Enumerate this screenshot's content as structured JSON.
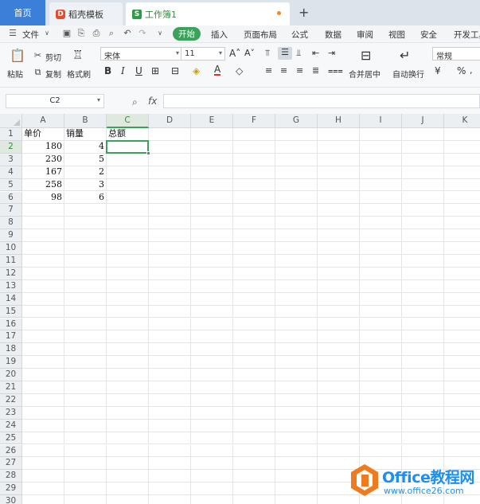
{
  "tabs": {
    "home": "首页",
    "template": "稻壳模板",
    "workbook": "工作簿1",
    "add": "+"
  },
  "menu": {
    "file": "文件",
    "items": [
      "开始",
      "插入",
      "页面布局",
      "公式",
      "数据",
      "审阅",
      "视图",
      "安全",
      "开发工具"
    ]
  },
  "ribbon": {
    "paste": "粘贴",
    "cut": "剪切",
    "copy": "复制",
    "format_painter": "格式刷",
    "font_name": "宋体",
    "font_size": "11",
    "bold": "B",
    "italic": "I",
    "underline": "U",
    "merge_center": "合并居中",
    "wrap_text": "自动换行",
    "number_format": "常规"
  },
  "formula_bar": {
    "name_box": "C2",
    "fx": "fx",
    "value": ""
  },
  "sheet": {
    "columns": [
      "A",
      "B",
      "C",
      "D",
      "E",
      "F",
      "G",
      "H",
      "I",
      "J",
      "K"
    ],
    "active_column": "C",
    "active_row": 2,
    "row_count": 30,
    "rows": [
      [
        "单价",
        "销量",
        "总额"
      ],
      [
        "180",
        "4",
        ""
      ],
      [
        "230",
        "5",
        ""
      ],
      [
        "167",
        "2",
        ""
      ],
      [
        "258",
        "3",
        ""
      ],
      [
        "98",
        "6",
        ""
      ]
    ]
  },
  "watermark": {
    "brand": "Office教程网",
    "url": "www.office26.com"
  },
  "colors": {
    "accent_green": "#3aa25a",
    "home_tab_blue": "#3c7fd8",
    "watermark_blue": "#1d8ff0",
    "watermark_orange": "#f07a1e"
  }
}
